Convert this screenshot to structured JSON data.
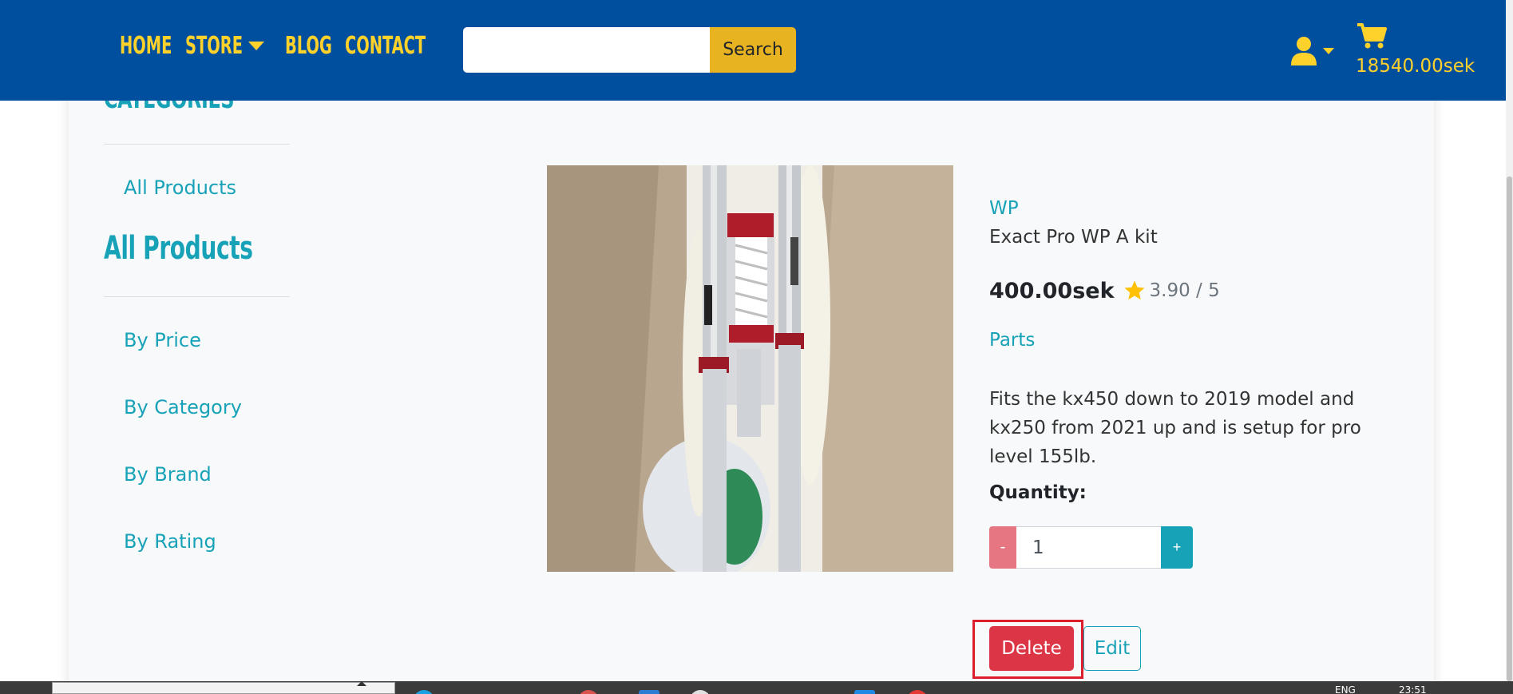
{
  "nav": {
    "links": [
      "HOME",
      "STORE",
      "BLOG",
      "CONTACT"
    ],
    "search_placeholder": "",
    "search_button": "Search",
    "cart_total": "18540.00sek"
  },
  "sidebar": {
    "categories_heading": "CATEGORIES",
    "categories_link": "All Products",
    "products_heading": "All Products",
    "sort_links": [
      "By Price",
      "By Category",
      "By Brand",
      "By Rating"
    ]
  },
  "product": {
    "brand": "WP",
    "name": "Exact Pro WP A kit",
    "price": "400.00sek",
    "rating": "3.90 / 5",
    "category": "Parts",
    "description": "Fits the kx450 down to 2019 model and kx250 from 2021 up and is setup for pro level 155lb.",
    "quantity_label": "Quantity:",
    "quantity_value": "1",
    "minus_label": "-",
    "plus_label": "+",
    "delete_label": "Delete",
    "edit_label": "Edit"
  },
  "taskbar": {
    "lang": "ENG",
    "time": "23:51"
  },
  "colors": {
    "navbar": "#004f9f",
    "nav_text": "#ffd12b",
    "search_button": "#e7b321",
    "accent": "#17a2b8",
    "delete": "#dc3545",
    "highlight_box": "#dc1d2b"
  },
  "icons": [
    "user-icon",
    "cart-icon",
    "star-icon",
    "caret-down-icon"
  ]
}
